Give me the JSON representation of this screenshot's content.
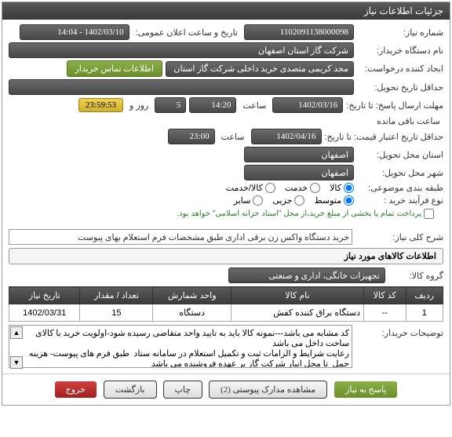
{
  "panel": {
    "title": "جزئیات اطلاعات نیاز"
  },
  "fields": {
    "need_no_label": "شماره نیاز:",
    "need_no": "1102091138000098",
    "announce_label": "تاریخ و ساعت اعلان عمومی:",
    "announce_value": "1402/03/10 - 14:04",
    "buyer_org_label": "نام دستگاه خریدار:",
    "buyer_org": "شرکت گاز استان اصفهان",
    "requester_label": "ایجاد کننده درخواست:",
    "requester": "مجد کریمی متصدی خرید داخلی شرکت گاز استان اصفهان",
    "contact_btn": "اطلاعات تماس خریدار",
    "deadline_label": "حداقل تاریخ تحویل:",
    "reply_deadline_label": "مهلت ارسال پاسخ: تا تاریخ:",
    "reply_date": "1402/03/16",
    "time_label": "ساعت",
    "reply_time": "14:20",
    "days_label": "روز و",
    "days_value": "5",
    "remaining_label": "ساعت باقی مانده",
    "remaining_time": "23:59:53",
    "validity_label": "حداقل تاریخ اعتبار قیمت: تا تاریخ:",
    "validity_date": "1402/04/16",
    "validity_time": "23:00",
    "place_label": "استان محل تحویل:",
    "place_value": "اصفهان",
    "city_label": "شهر محل تحویل:",
    "city_value": "اصفهان",
    "topic_class_label": "طبقه بندی موضوعی:",
    "purchase_type_label": "نوع فرآیند خرید :",
    "opts": {
      "goods": "کالا",
      "service": "خدمت",
      "goods_service": "کالا/خدمت",
      "medium": "متوسط",
      "partial": "جزیی",
      "other": "سایر"
    },
    "payment_note": "پرداخت تمام یا بخشی از مبلغ خرید،از محل \"اسناد خزانه اسلامی\" خواهد بود.",
    "desc_title_label": "شرح کلی نیاز:",
    "desc_title": "خرید دستگاه واکس زن برقی اداری طبق مشخصات فرم استعلام بهای پیوست",
    "items_header": "اطلاعات کالاهای مورد نیاز",
    "group_label": "گروه کالا:",
    "group_value": "تجهیزات خانگی، اداری و صنعتی",
    "buyer_notes_label": "توضیحات خریدار:",
    "buyer_notes": "کد مشابه می باشد---نمونه کالا باید به تایید واحد متقاضی رسیده شود-اولویت خرید با کالای ساخت داخل می باشد\nرعایت شرایط و الزامات ثبت و تکمیل استعلام در سامانه ستاد  طبق فرم های پیوست- هزینه حمل  تا محل انبار شرکت گاز بر عهده فروشنده می باشد"
  },
  "table": {
    "headers": {
      "row": "ردیف",
      "code": "کد کالا",
      "name": "نام کالا",
      "unit": "واحد شمارش",
      "qty": "تعداد / مقدار",
      "date": "تاریخ نیاز"
    },
    "rows": [
      {
        "row": "1",
        "code": "--",
        "name": "دستگاه براق کننده کفش",
        "unit": "دستگاه",
        "qty": "15",
        "date": "1402/03/31"
      }
    ]
  },
  "footer": {
    "respond": "پاسخ به نیاز",
    "attachments": "مشاهده مدارک پیوستی (2)",
    "print": "چاپ",
    "back": "بازگشت",
    "exit": "خروج"
  }
}
